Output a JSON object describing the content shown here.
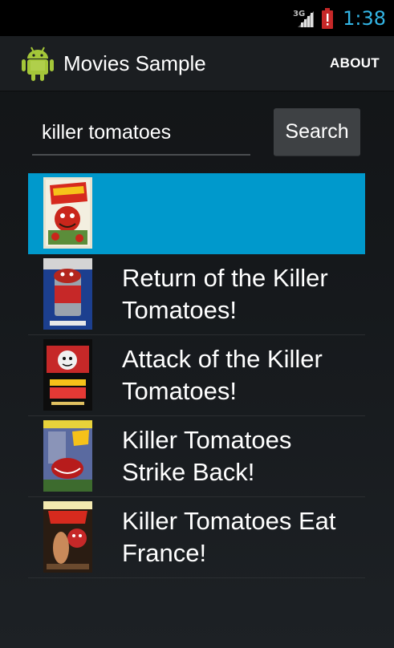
{
  "status_bar": {
    "network": "3G",
    "time": "1:38"
  },
  "action_bar": {
    "title": "Movies Sample",
    "about_label": "ABOUT",
    "app_icon": "android-robot-icon"
  },
  "search": {
    "query": "killer tomatoes",
    "button_label": "Search"
  },
  "results": [
    {
      "title": "",
      "poster": "Attack of the Killer Tomatoes poster",
      "selected": true
    },
    {
      "title": "Return of the Killer\nTomatoes!",
      "poster": "tomato can poster"
    },
    {
      "title": "Attack of the Killer\nTomatoes!",
      "poster": "killer tomatoes poster"
    },
    {
      "title": "Killer Tomatoes\nStrike Back!",
      "poster": "tomato monster poster"
    },
    {
      "title": "Killer Tomatoes Eat\nFrance!",
      "poster": "eat france poster"
    }
  ],
  "colors": {
    "accent": "#33b5e5",
    "selected_row": "#0099cc"
  }
}
